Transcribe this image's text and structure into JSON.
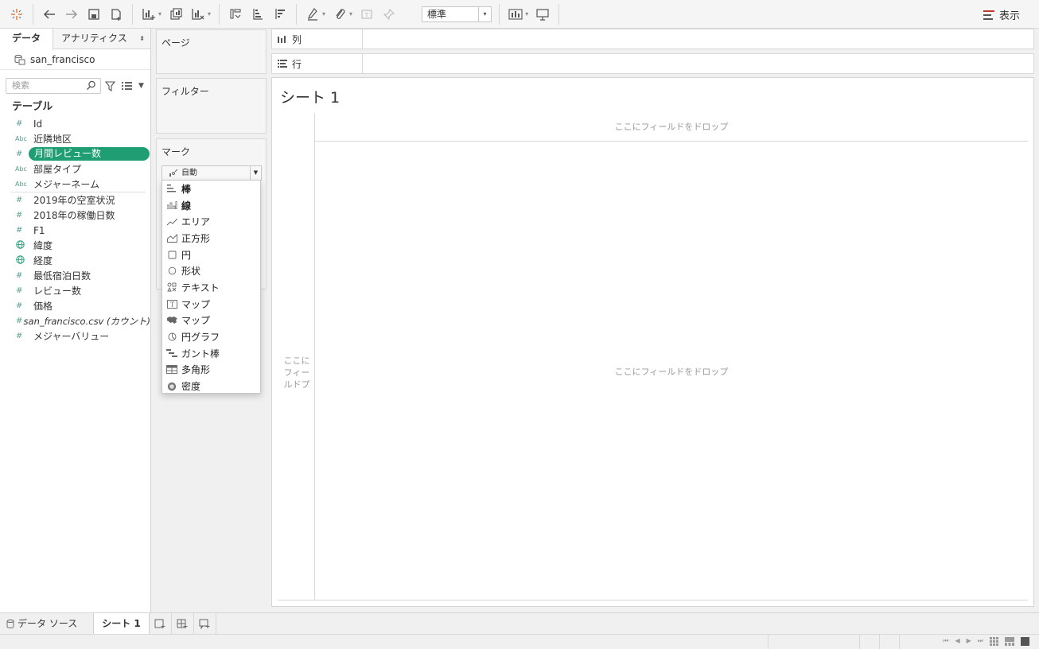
{
  "toolbar": {
    "standard_select": "標準",
    "show_label": "表示"
  },
  "data_pane": {
    "tab_data": "データ",
    "tab_analytics": "アナリティクス",
    "datasource": "san_francisco",
    "search_placeholder": "検索",
    "section_title": "テーブル",
    "dimensions": [
      {
        "type": "#",
        "label": "Id"
      },
      {
        "type": "Abc",
        "label": "近隣地区"
      },
      {
        "type": "#",
        "label": "月間レビュー数"
      },
      {
        "type": "Abc",
        "label": "部屋タイプ"
      },
      {
        "type": "Abc",
        "label": "メジャーネーム"
      }
    ],
    "measures": [
      {
        "type": "#",
        "label": "2019年の空室状況"
      },
      {
        "type": "#",
        "label": "2018年の稼働日数"
      },
      {
        "type": "#",
        "label": "F1"
      },
      {
        "type": "globe",
        "label": "緯度"
      },
      {
        "type": "globe",
        "label": "経度"
      },
      {
        "type": "#",
        "label": "最低宿泊日数"
      },
      {
        "type": "#",
        "label": "レビュー数"
      },
      {
        "type": "#",
        "label": "価格"
      },
      {
        "type": "#",
        "label": "san_francisco.csv (カウント)"
      },
      {
        "type": "#",
        "label": "メジャーバリュー"
      }
    ]
  },
  "cards": {
    "pages": "ページ",
    "filters": "フィルター",
    "marks": "マーク",
    "marks_select": "自動"
  },
  "marks_dropdown": [
    {
      "icon": "auto-icon",
      "label": "棒"
    },
    {
      "icon": "bar-icon",
      "label": "線"
    },
    {
      "icon": "line-icon",
      "label": "エリア"
    },
    {
      "icon": "area-icon",
      "label": "正方形"
    },
    {
      "icon": "square-icon",
      "label": "円"
    },
    {
      "icon": "circle-icon",
      "label": "形状"
    },
    {
      "icon": "shape-icon",
      "label": "テキスト"
    },
    {
      "icon": "text-icon",
      "label": "マップ"
    },
    {
      "icon": "map-icon",
      "label": "マップ"
    },
    {
      "icon": "pie-icon",
      "label": "円グラフ"
    },
    {
      "icon": "gantt-icon",
      "label": "ガント棒"
    },
    {
      "icon": "polygon-icon",
      "label": "多角形"
    },
    {
      "icon": "density-icon",
      "label": "密度"
    }
  ],
  "shelves": {
    "columns": "列",
    "rows": "行"
  },
  "sheet": {
    "title": "シート 1",
    "drop_top": "ここにフィールドをドロップ",
    "drop_left": "ここに フィー ルドプ",
    "drop_center": "ここにフィールドをドロップ"
  },
  "bottom": {
    "datasource_tab": "データ ソース",
    "sheet_tab": "シート 1"
  }
}
